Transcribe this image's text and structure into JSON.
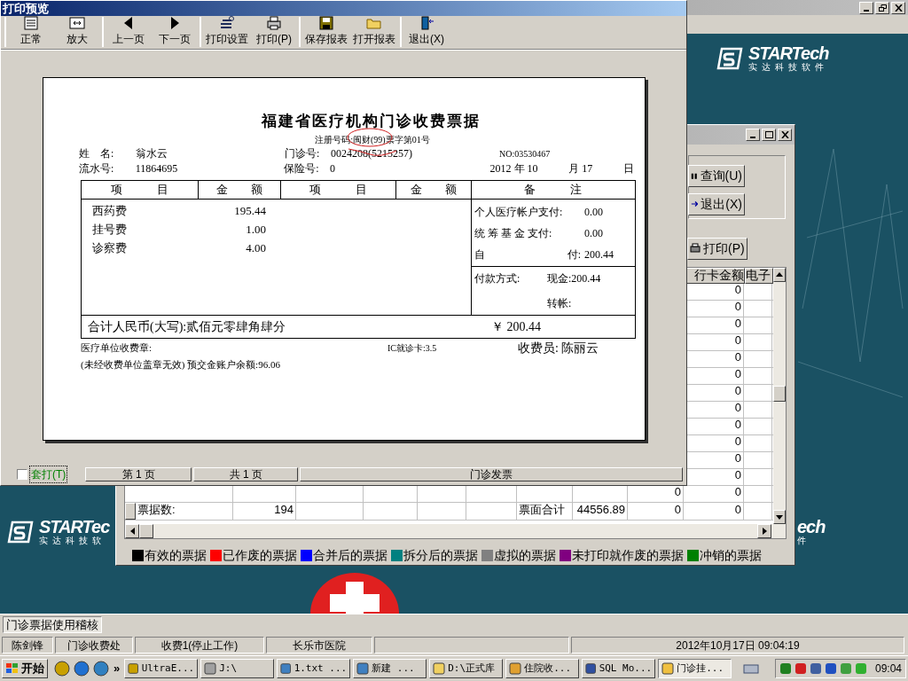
{
  "desktop_app": {
    "logos": [
      {
        "brand": "STARTech",
        "subtitle": "实达科技软件"
      },
      {
        "brand": "STARTec",
        "subtitle": "实达科技软"
      },
      {
        "brand": "ech",
        "subtitle": "件"
      }
    ],
    "tabs": [
      {
        "label": "门诊票据使用稽核",
        "selected": true
      }
    ],
    "status_bar": [
      "陈剑锋",
      "门诊收费处",
      "收费1(停止工作)",
      "长乐市医院",
      "2012年10月17日 09:04:19"
    ]
  },
  "audit_window": {
    "buttons": [
      "查询(U)",
      "退出(X)"
    ],
    "print_button": "打印(P)",
    "grid": {
      "header": {
        "bank_card": "行卡金额",
        "e_pay": "电子"
      },
      "rows": [
        {
          "bank_card": "0"
        },
        {
          "bank_card": "0"
        },
        {
          "bank_card": "0"
        },
        {
          "bank_card": "0"
        },
        {
          "bank_card": "0"
        },
        {
          "bank_card": "0"
        },
        {
          "bank_card": "0"
        },
        {
          "bank_card": "0"
        },
        {
          "bank_card": "0"
        },
        {
          "bank_card": "0"
        },
        {
          "bank_card": "0"
        },
        {
          "bank_card": "0"
        },
        {
          "cash_card": "0",
          "bank_card": "0"
        }
      ],
      "summary": {
        "label": "票据数:",
        "count": "194",
        "total_label": "票面合计",
        "total": "44556.89",
        "cash_card": "0",
        "bank_card": "0"
      }
    },
    "legend": [
      {
        "label": "有效的票据",
        "color": "#000000"
      },
      {
        "label": "已作废的票据",
        "color": "#ff0000"
      },
      {
        "label": "合并后的票据",
        "color": "#0000ff"
      },
      {
        "label": "拆分后的票据",
        "color": "#008080"
      },
      {
        "label": "虚拟的票据",
        "color": "#808080"
      },
      {
        "label": "未打印就作废的票据",
        "color": "#800080"
      },
      {
        "label": "冲销的票据",
        "color": "#008000"
      }
    ]
  },
  "preview_window": {
    "title": "打印预览",
    "toolbar_groups": [
      [
        "正常",
        "放大"
      ],
      [
        "上一页",
        "下一页"
      ],
      [
        "打印设置",
        "打印(P)"
      ],
      [
        "保存报表",
        "打开报表"
      ],
      [
        "退出(X)"
      ]
    ],
    "receipt": {
      "title": "福建省医疗机构门诊收费票据",
      "registration": "注册号码:闽财(99)票字第01号",
      "name_label": "姓　名:",
      "name": "翁水云",
      "clinic_no_label": "门诊号:",
      "clinic_no": "0024208(5215257)",
      "receipt_no": "NO:03530467",
      "serial_label": "流水号:",
      "serial": "11864695",
      "insurance_label": "保险号:",
      "insurance": "0",
      "date_parts": [
        "2012 年 10",
        "月 17",
        "日"
      ],
      "columns": [
        "项　　　目",
        "金　　额",
        "项　　　目",
        "金　　额",
        "备　　　注"
      ],
      "items": [
        {
          "name": "西药费",
          "amount": "195.44"
        },
        {
          "name": "挂号费",
          "amount": "1.00"
        },
        {
          "name": "诊察费",
          "amount": "4.00"
        }
      ],
      "remarks": [
        {
          "label": "个人医疗帐户支付:",
          "value": "0.00"
        },
        {
          "label": "统 筹 基 金 支付:",
          "value": "0.00"
        },
        {
          "label": "自",
          "label_end": "付:",
          "value": "200.44"
        }
      ],
      "payment_label": "付款方式:",
      "payments": [
        {
          "label": "现金:",
          "value": "200.44"
        },
        {
          "label": "转帐:"
        }
      ],
      "total_words": "合计人民币(大写):贰佰元零肆角肆分",
      "total_amount": "￥ 200.44",
      "stamp": "医疗单位收费章:",
      "ic_card": "IC就诊卡:3.5",
      "cashier": "收费员: 陈丽云",
      "note": "(未经收费单位盖章无效) 预交金账户余额:96.06"
    },
    "overprint": {
      "label": "套打(T)",
      "checked": false
    },
    "page": "第 1 页",
    "page_total": "共 1 页",
    "report": "门诊发票"
  },
  "taskbar": {
    "start": "开始",
    "more": "»",
    "tasks": [
      {
        "label": "UltraE...",
        "selected": false
      },
      {
        "label": "J:\\",
        "selected": false
      },
      {
        "label": "1.txt ...",
        "selected": false
      },
      {
        "label": "新建 ...",
        "selected": false
      },
      {
        "label": "D:\\正式库",
        "selected": false
      },
      {
        "label": "住院收...",
        "selected": false
      },
      {
        "label": "SQL Mo...",
        "selected": false
      },
      {
        "label": "门诊挂...",
        "selected": true
      }
    ],
    "clock": "09:04"
  }
}
